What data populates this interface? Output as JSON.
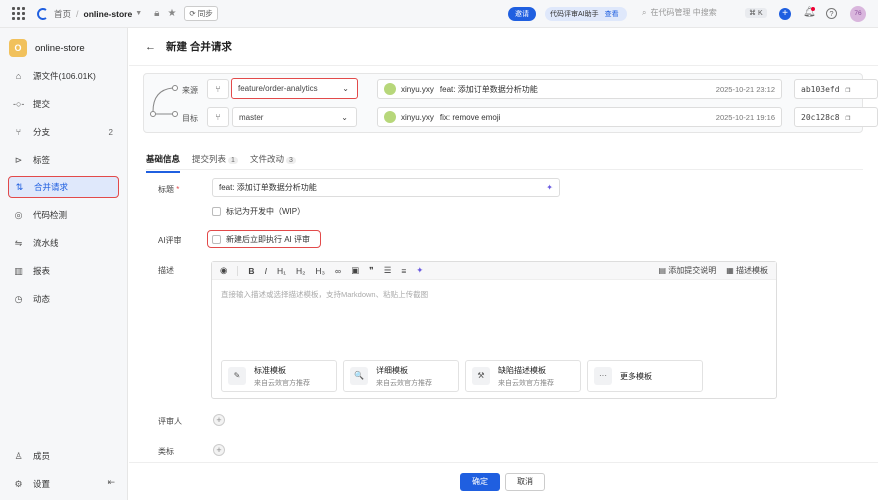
{
  "topbar": {
    "home": "首页",
    "repo": "online-store",
    "sync": "同步",
    "invite": "邀请",
    "ai_assistant": "代码评审AI助手",
    "ai_view": "查看",
    "search_placeholder": "在代码管理 中搜索",
    "shortcut": "⌘ K",
    "user_initials": "76"
  },
  "sidebar": {
    "repo_initial": "O",
    "repo_name": "online-store",
    "items": [
      {
        "label": "源文件(106.01K)",
        "icon": "file-icon"
      },
      {
        "label": "提交",
        "icon": "commit-icon"
      },
      {
        "label": "分支",
        "icon": "branch-icon",
        "count": "2"
      },
      {
        "label": "标签",
        "icon": "tag-icon"
      },
      {
        "label": "合并请求",
        "icon": "merge-request-icon"
      },
      {
        "label": "代码检测",
        "icon": "scan-icon"
      },
      {
        "label": "流水线",
        "icon": "pipeline-icon"
      },
      {
        "label": "报表",
        "icon": "report-icon"
      },
      {
        "label": "动态",
        "icon": "activity-icon"
      }
    ],
    "bottom": [
      {
        "label": "成员",
        "icon": "member-icon"
      },
      {
        "label": "设置",
        "icon": "settings-icon"
      }
    ]
  },
  "page": {
    "title": "新建 合并请求",
    "source_label": "来源",
    "target_label": "目标",
    "source_branch": "feature/order-analytics",
    "target_branch": "master",
    "source_commit": {
      "user": "xinyu.yxy",
      "message": "feat: 添加订单数据分析功能",
      "date": "2025-10-21 23:12",
      "sha": "ab103efd"
    },
    "target_commit": {
      "user": "xinyu.yxy",
      "message": "fix: remove emoji",
      "date": "2025-10-21 19:16",
      "sha": "20c128c8"
    }
  },
  "tabs": [
    {
      "label": "基础信息",
      "count": ""
    },
    {
      "label": "提交列表",
      "count": "1"
    },
    {
      "label": "文件改动",
      "count": "3"
    }
  ],
  "form": {
    "title_label": "标题",
    "title_value": "feat: 添加订单数据分析功能",
    "wip_label": "标记为开发中（WIP）",
    "ai_review_label": "AI评审",
    "ai_review_option": "新建后立即执行 AI 评审",
    "desc_label": "描述",
    "add_commit_desc": "添加提交说明",
    "desc_template": "描述模板",
    "desc_placeholder": "直接输入描述或选择描述模板，支持Markdown、粘贴上传截图",
    "reviewer_label": "评审人",
    "type_label": "类标"
  },
  "templates": [
    {
      "title": "标准模板",
      "sub": "来自云效官方推荐",
      "icon": "✎"
    },
    {
      "title": "详细模板",
      "sub": "来自云效官方推荐",
      "icon": "🔍"
    },
    {
      "title": "缺陷描述模板",
      "sub": "来自云效官方推荐",
      "icon": "⚒"
    },
    {
      "title": "更多模板",
      "sub": "",
      "icon": "···"
    }
  ],
  "footer": {
    "ok": "确定",
    "cancel": "取消"
  }
}
